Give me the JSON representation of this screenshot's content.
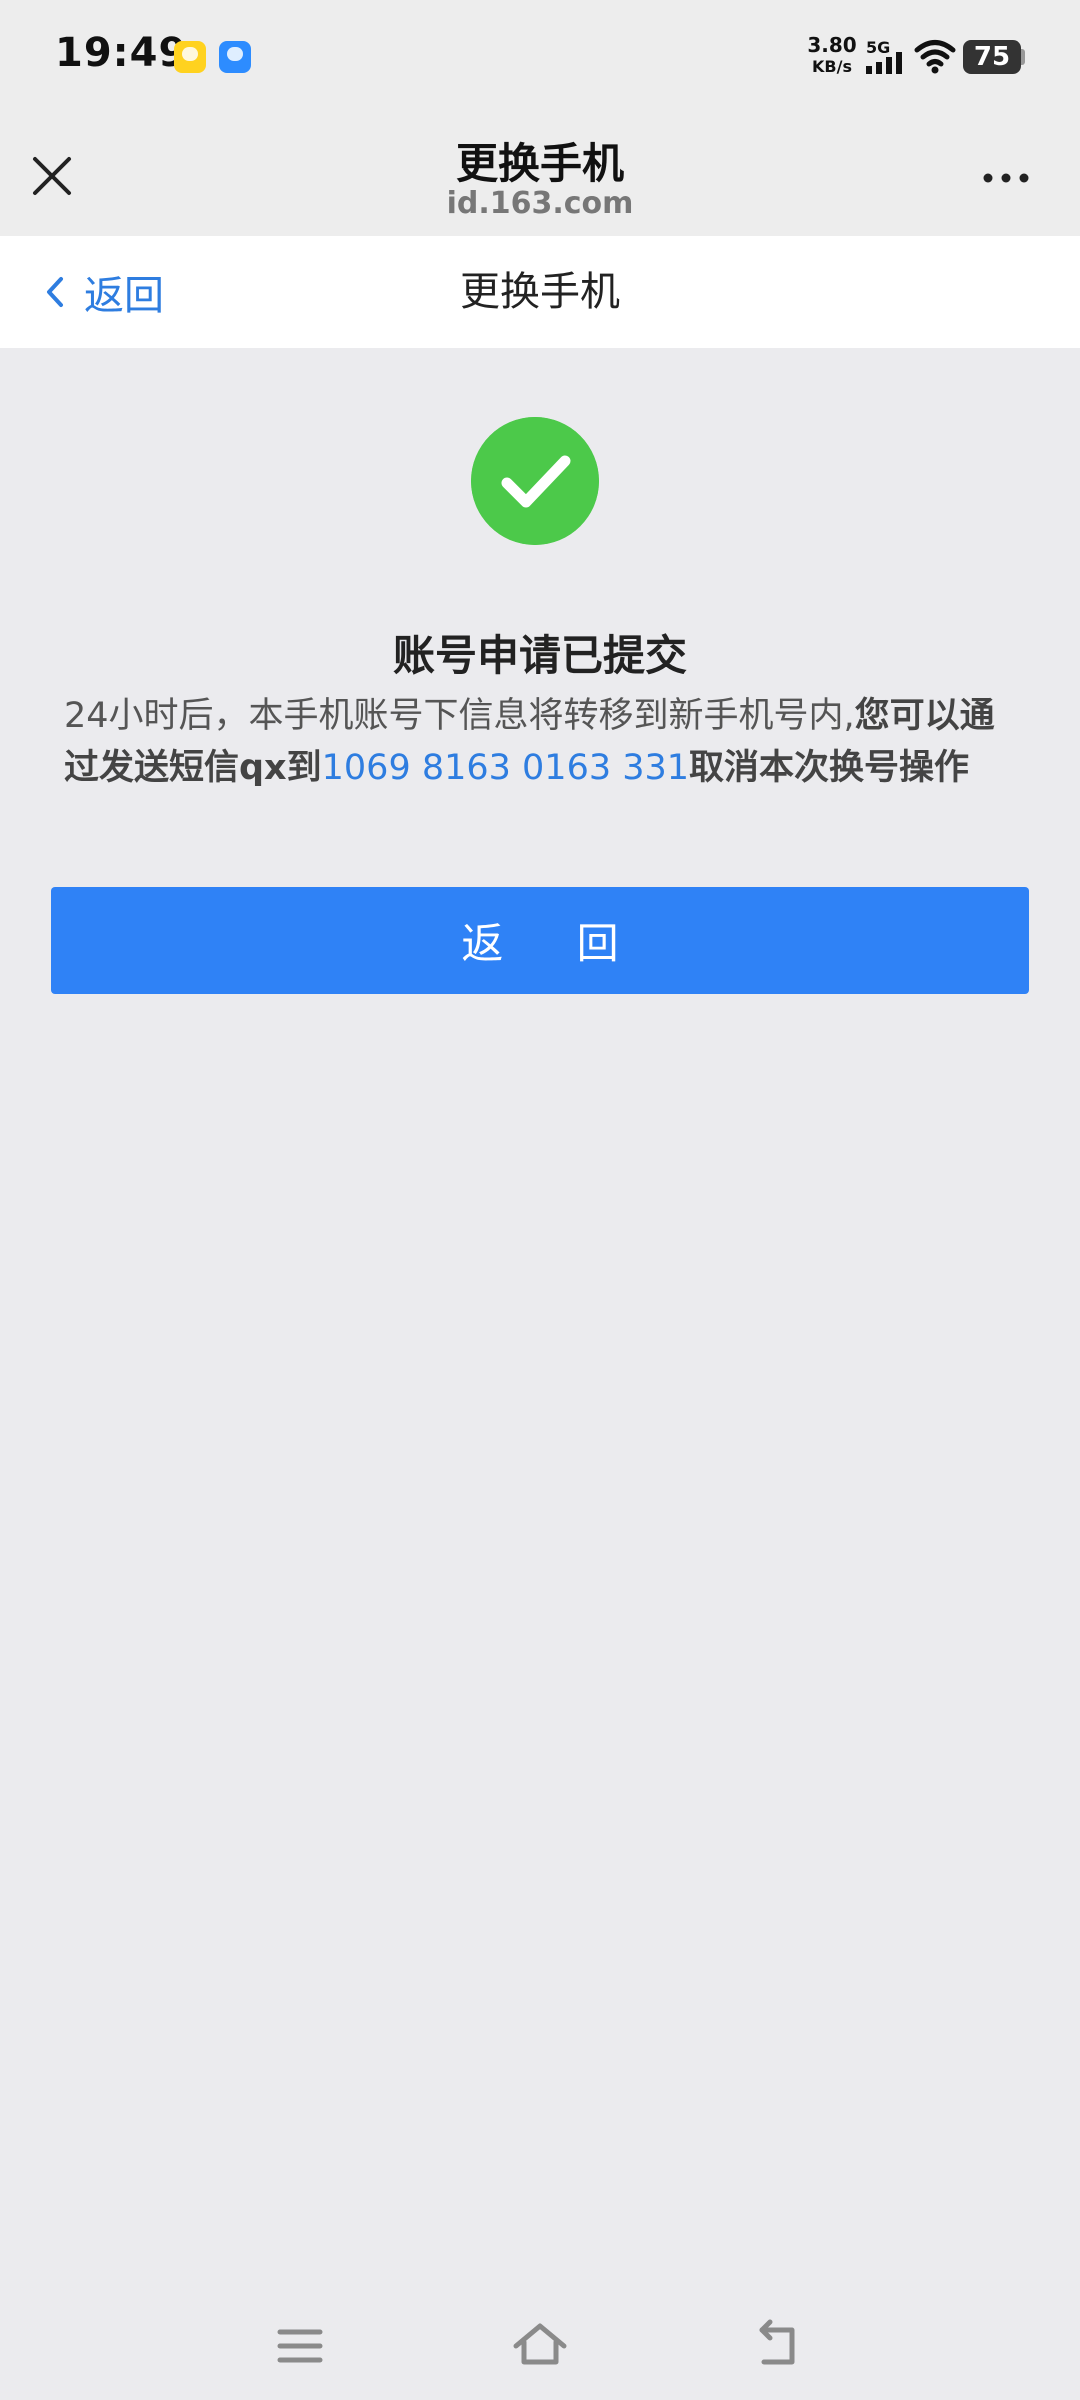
{
  "status_bar": {
    "time": "19:49",
    "network_speed_value": "3.80",
    "network_speed_unit": "KB/s",
    "network_type": "5G",
    "battery_level": "75",
    "notification_icons": [
      "app-notification-icon-yellow",
      "app-notification-icon-blue"
    ]
  },
  "browser_header": {
    "title": "更换手机",
    "url": "id.163.com",
    "close_icon": "close-icon",
    "more_icon": "more-icon"
  },
  "page_nav": {
    "back_label": "返回",
    "title": "更换手机"
  },
  "result": {
    "icon": "check-circle-icon",
    "icon_color": "#4cc94a",
    "title": "账号申请已提交",
    "message_part1": "24小时后，本手机账号下信息将转移到新手机号内,",
    "message_part2": "您可以通过发送短信qx到",
    "message_number": "1069 8163 0163 331",
    "message_part3": "取消本次换号操作"
  },
  "primary_button": {
    "label": "返 回",
    "color": "#2f82f6"
  },
  "system_nav": {
    "icons": [
      "menu-icon",
      "home-icon",
      "back-icon"
    ]
  }
}
